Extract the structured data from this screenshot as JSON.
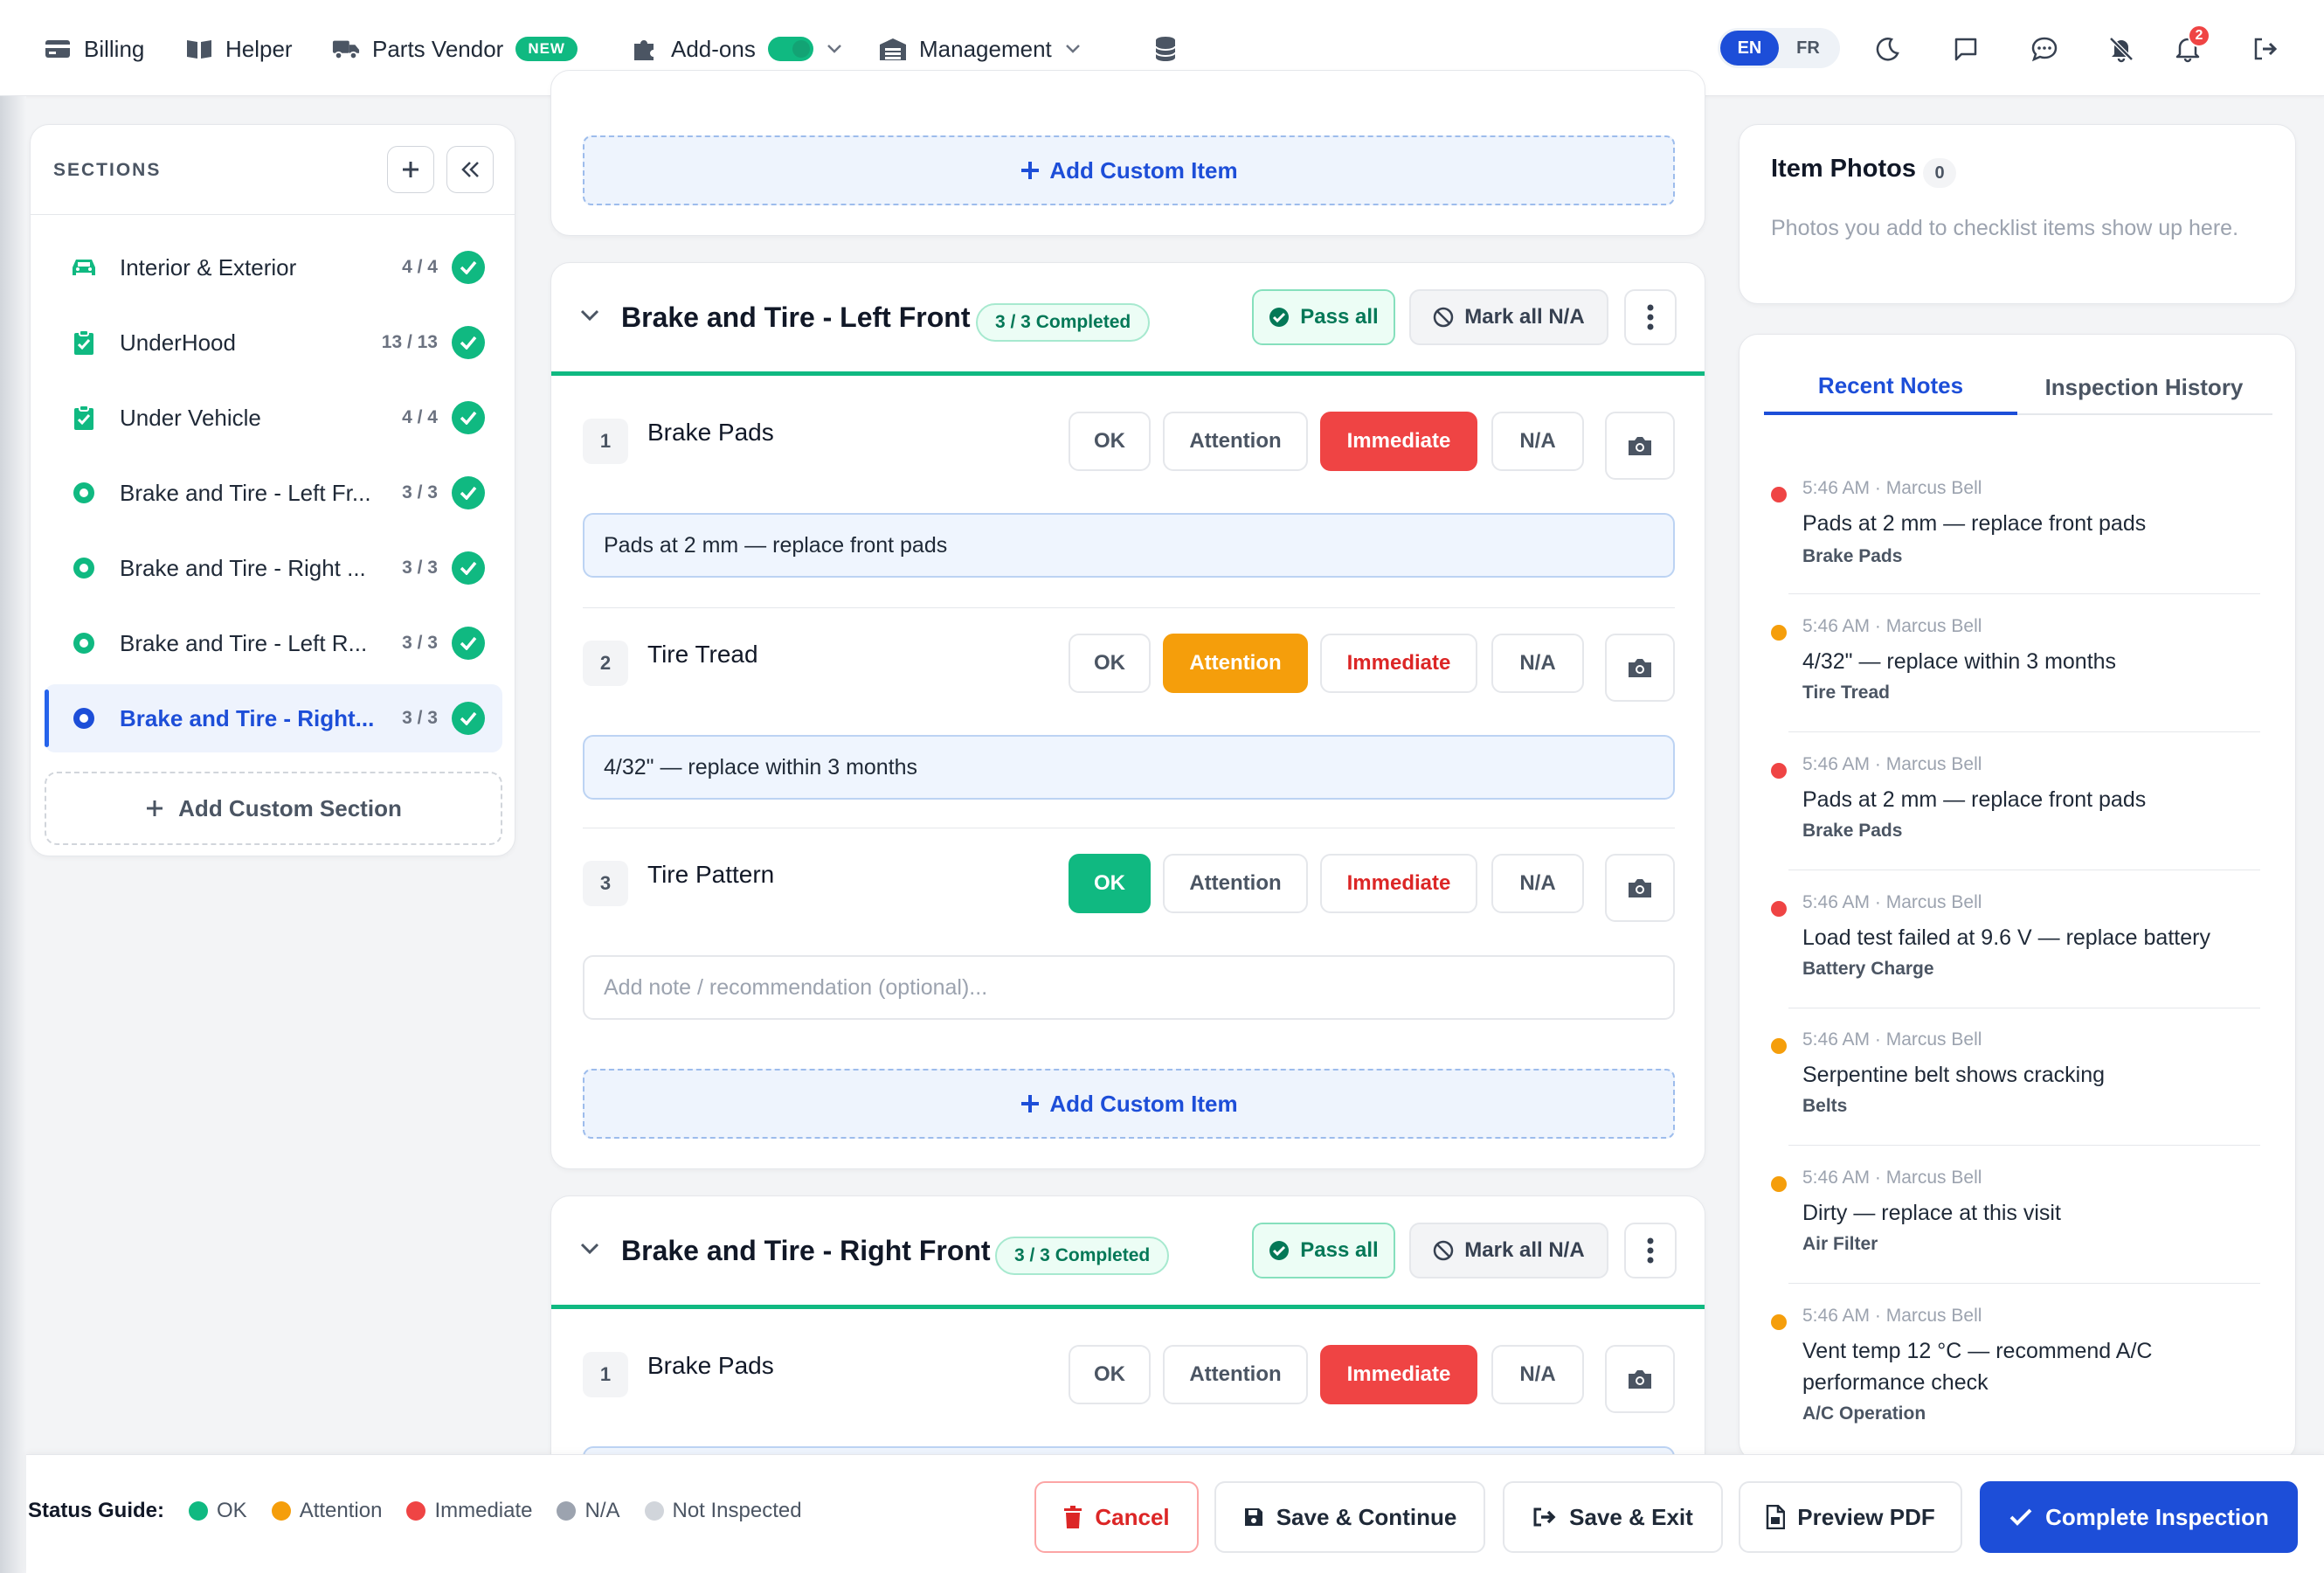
{
  "topbar": {
    "nav": [
      {
        "label": "Billing",
        "icon": "credit-card-icon"
      },
      {
        "label": "Helper",
        "icon": "book-icon"
      },
      {
        "label": "Parts Vendor",
        "icon": "truck-icon",
        "badge": "NEW"
      },
      {
        "label": "Add-ons",
        "icon": "puzzle-icon",
        "toggle": true
      },
      {
        "label": "Management",
        "icon": "warehouse-icon"
      }
    ],
    "languages": [
      "EN",
      "FR"
    ],
    "active_language": "EN",
    "notification_count": "2"
  },
  "sidebar": {
    "title": "SECTIONS",
    "items": [
      {
        "label": "Interior & Exterior",
        "count": "4 / 4",
        "icon": "car-icon",
        "active": false
      },
      {
        "label": "UnderHood",
        "count": "13 / 13",
        "icon": "clipboard-check-icon",
        "active": false
      },
      {
        "label": "Under Vehicle",
        "count": "4 / 4",
        "icon": "clipboard-check-icon",
        "active": false
      },
      {
        "label": "Brake and Tire - Left Fr...",
        "count": "3 / 3",
        "icon": "radio-dot-icon",
        "active": false
      },
      {
        "label": "Brake and Tire - Right ...",
        "count": "3 / 3",
        "icon": "radio-dot-icon",
        "active": false
      },
      {
        "label": "Brake and Tire - Left R...",
        "count": "3 / 3",
        "icon": "radio-dot-icon",
        "active": false
      },
      {
        "label": "Brake and Tire - Right...",
        "count": "3 / 3",
        "icon": "radio-dot-icon",
        "active": true
      }
    ],
    "add_section_label": "Add Custom Section"
  },
  "main": {
    "add_custom_item_label": "Add Custom Item",
    "options": {
      "ok": "OK",
      "attention": "Attention",
      "immediate": "Immediate",
      "na": "N/A"
    },
    "pass_all_label": "Pass all",
    "mark_all_na_label": "Mark all N/A",
    "note_placeholder": "Add note / recommendation (optional)...",
    "sections": [
      {
        "title": "Brake and Tire - Left Front",
        "completed": "3 / 3 Completed",
        "items": [
          {
            "num": "1",
            "name": "Brake Pads",
            "status": "immediate",
            "note": "Pads at 2 mm — replace front pads"
          },
          {
            "num": "2",
            "name": "Tire Tread",
            "status": "attention",
            "note": "4/32\" — replace within 3 months"
          },
          {
            "num": "3",
            "name": "Tire Pattern",
            "status": "ok",
            "note": ""
          }
        ]
      },
      {
        "title": "Brake and Tire - Right Front",
        "completed": "3 / 3 Completed",
        "items": [
          {
            "num": "1",
            "name": "Brake Pads",
            "status": "immediate",
            "note": ""
          }
        ]
      }
    ]
  },
  "photos": {
    "title": "Item Photos",
    "count": "0",
    "description": "Photos you add to checklist items show up here."
  },
  "notes_panel": {
    "tabs": [
      "Recent Notes",
      "Inspection History"
    ],
    "active_tab": "Recent Notes",
    "notes": [
      {
        "meta": "5:46 AM · Marcus Bell",
        "text": "Pads at 2 mm — replace front pads",
        "item": "Brake Pads",
        "severity": "immediate"
      },
      {
        "meta": "5:46 AM · Marcus Bell",
        "text": "4/32\" — replace within 3 months",
        "item": "Tire Tread",
        "severity": "attention"
      },
      {
        "meta": "5:46 AM · Marcus Bell",
        "text": "Pads at 2 mm — replace front pads",
        "item": "Brake Pads",
        "severity": "immediate"
      },
      {
        "meta": "5:46 AM · Marcus Bell",
        "text": "Load test failed at 9.6 V — replace battery",
        "item": "Battery Charge",
        "severity": "immediate"
      },
      {
        "meta": "5:46 AM · Marcus Bell",
        "text": "Serpentine belt shows cracking",
        "item": "Belts",
        "severity": "attention"
      },
      {
        "meta": "5:46 AM · Marcus Bell",
        "text": "Dirty — replace at this visit",
        "item": "Air Filter",
        "severity": "attention"
      },
      {
        "meta": "5:46 AM · Marcus Bell",
        "text": "Vent temp 12 °C — recommend A/C performance check",
        "item": "A/C Operation",
        "severity": "attention"
      }
    ]
  },
  "status_guide": {
    "label": "Status Guide:",
    "items": [
      {
        "label": "OK",
        "color": "#10b981"
      },
      {
        "label": "Attention",
        "color": "#f59e0b"
      },
      {
        "label": "Immediate",
        "color": "#ef4444"
      },
      {
        "label": "N/A",
        "color": "#9ca3af"
      },
      {
        "label": "Not Inspected",
        "color": "#d1d5db"
      }
    ]
  },
  "actions": {
    "cancel": "Cancel",
    "save_continue": "Save & Continue",
    "save_exit": "Save & Exit",
    "preview_pdf": "Preview PDF",
    "complete": "Complete Inspection"
  },
  "colors": {
    "accent": "#1d4ed8",
    "ok": "#10b981",
    "attention": "#f59e0b",
    "immediate": "#ef4444"
  }
}
